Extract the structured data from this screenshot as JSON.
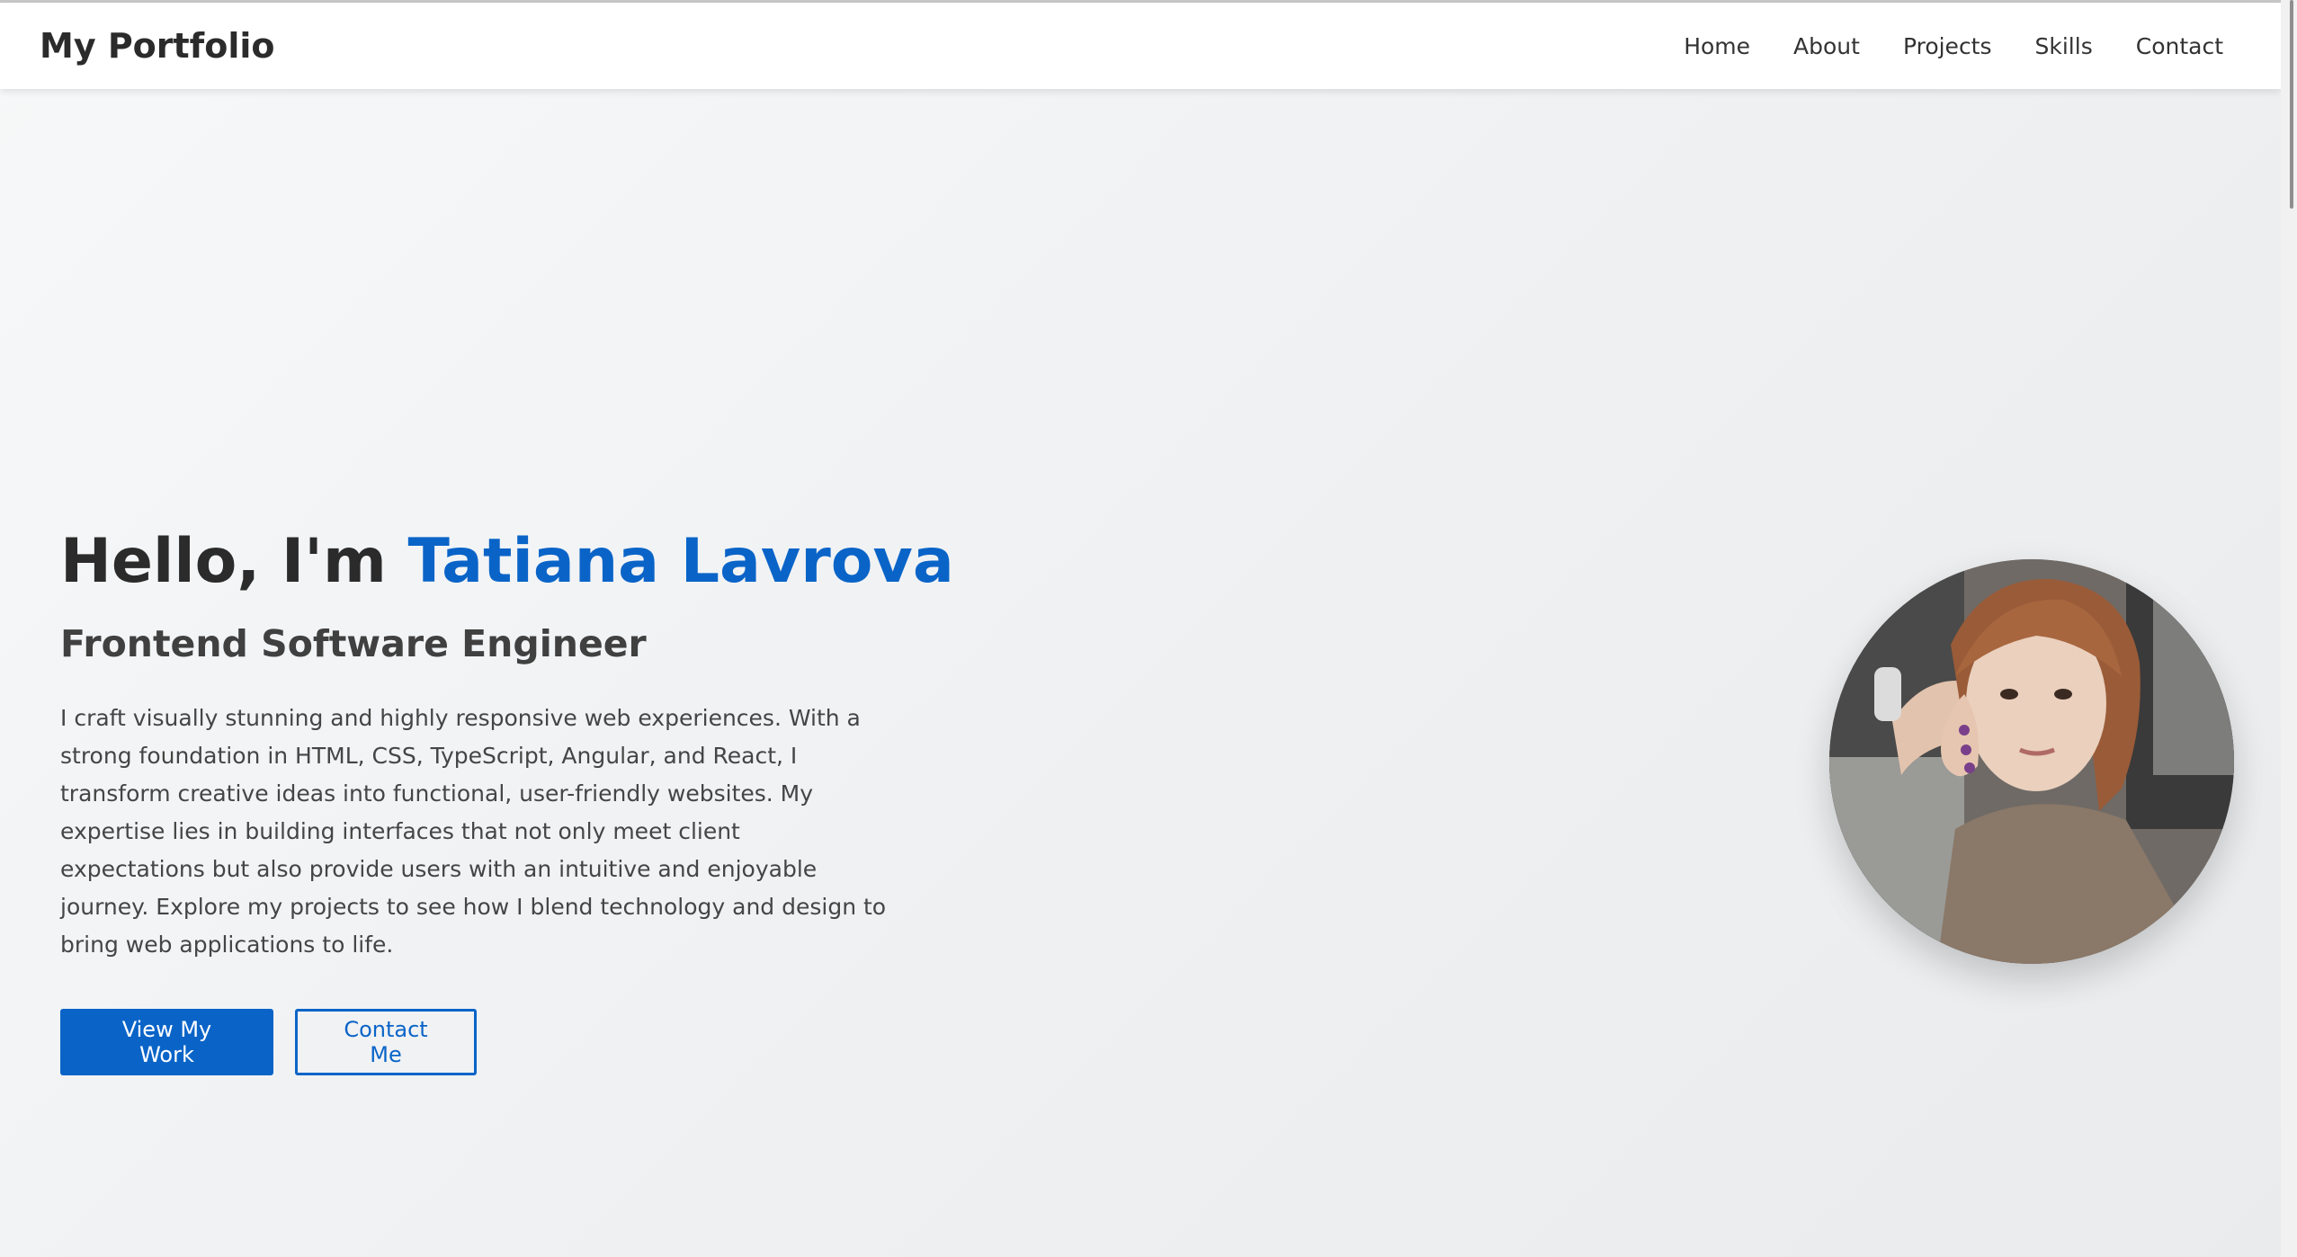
{
  "brand": "My Portfolio",
  "nav": {
    "home": "Home",
    "about": "About",
    "projects": "Projects",
    "skills": "Skills",
    "contact": "Contact"
  },
  "hero": {
    "greeting": "Hello, I'm ",
    "name": "Tatiana Lavrova",
    "role": "Frontend Software Engineer",
    "bio": "I craft visually stunning and highly responsive web experiences. With a strong foundation in HTML, CSS, TypeScript, Angular, and React, I transform creative ideas into functional, user-friendly websites. My expertise lies in building interfaces that not only meet client expectations but also provide users with an intuitive and enjoyable journey. Explore my projects to see how I blend technology and design to bring web applications to life.",
    "primary_button": "View My Work",
    "secondary_button": "Contact Me"
  },
  "colors": {
    "accent": "#0a64c8",
    "heading": "#2b2b2b",
    "background": "#f3f4f6"
  }
}
